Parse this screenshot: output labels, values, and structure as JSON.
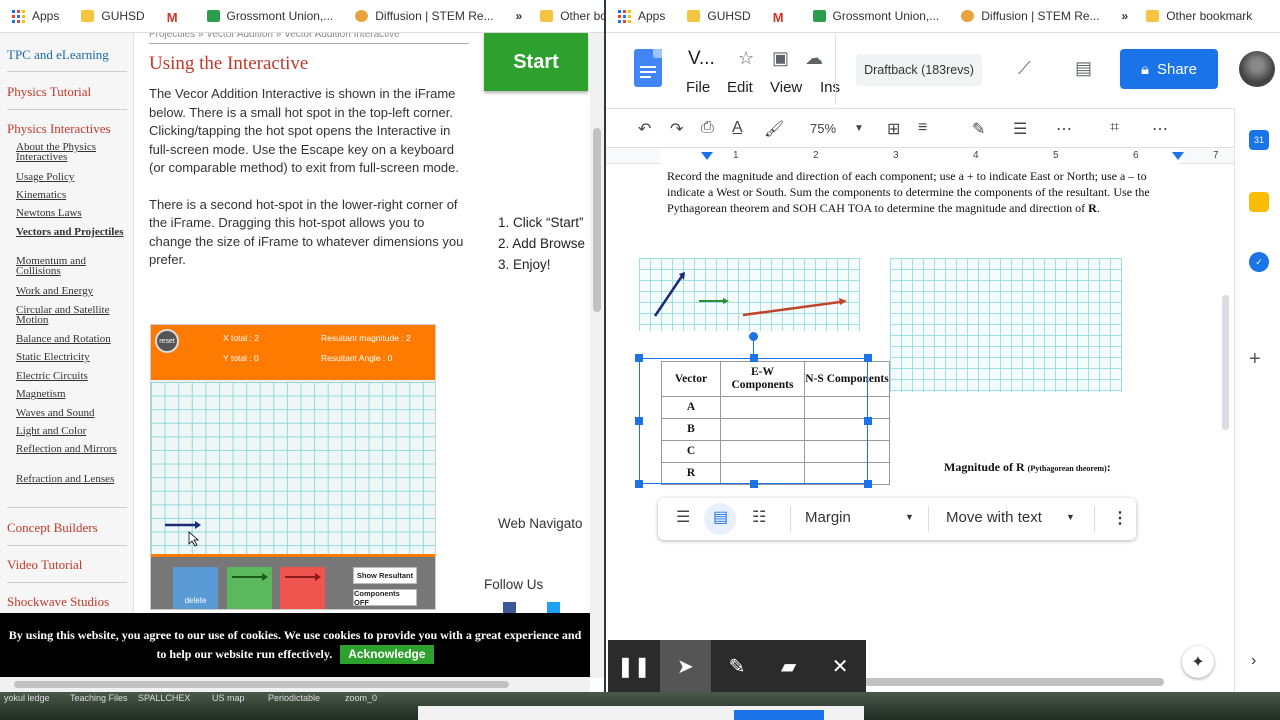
{
  "bookmarks": {
    "apps": "Apps",
    "guhsd": "GUHSD",
    "gmail": "M",
    "grossmont": "Grossmont Union,...",
    "diffusion": "Diffusion | STEM Re...",
    "more": "»",
    "other": "Other bookmarks",
    "other_cut": "Other bookmark"
  },
  "nav": {
    "top": "TPC and eLearning",
    "tutorial": "Physics Tutorial",
    "interactives": "Physics Interactives",
    "subitems": [
      "About the Physics Interactives",
      "Usage Policy",
      "Kinematics",
      "Newtons Laws",
      "Vectors and Projectiles",
      "Momentum and Collisions",
      "Work and Energy",
      "Circular and Satellite Motion",
      "Balance and Rotation",
      "Static Electricity",
      "Electric Circuits",
      "Magnetism",
      "Waves and Sound",
      "Light and Color",
      "Reflection and Mirrors",
      "Refraction and Lenses"
    ],
    "concept": "Concept Builders",
    "video": "Video Tutorial",
    "shockwave": "Shockwave Studios"
  },
  "content": {
    "breadcrumb": "Projectiles » Vector Addition » Vector Addition Interactive",
    "heading": "Using the Interactive",
    "p1": "The Vecor Addition Interactive is shown in the iFrame below. There is a small hot spot in the top-left corner. Clicking/tapping the hot spot opens the Interactive in full-screen mode. Use the Escape key on a keyboard (or comparable method) to exit from full-screen mode.",
    "p2": "There is a second hot-spot in the lower-right corner of the iFrame. Dragging this hot-spot allows you to change the size of iFrame to whatever dimensions you prefer.",
    "start": "Start",
    "steps": [
      "1. Click “Start”",
      "2. Add Browse",
      "3. Enjoy!"
    ],
    "web_nav": "Web Navigato",
    "follow": "Follow Us"
  },
  "interactive": {
    "reset": "reset",
    "x_total": "X total :  2",
    "y_total": "Y total :  0",
    "res_mag": "Resultant magnitude :  2",
    "res_angle": "Resultant Angle :  0",
    "delete": "delete",
    "show_resultant": "Show Resultant",
    "components": "Components OFF",
    "colors": {
      "orange": "#ff7a00",
      "blue": "#5b9bd5",
      "green": "#5cb85c",
      "red": "#f0544f"
    }
  },
  "cookie": {
    "text": "By using this website, you agree to our use of cookies. We use cookies to provide you with a great experience and to help our website run effectively.",
    "button": "Acknowledge"
  },
  "docs": {
    "title": "V...",
    "menus": [
      "File",
      "Edit",
      "View",
      "Ins"
    ],
    "draftback": "Draftback (183revs)",
    "share": "Share",
    "zoom": "75%",
    "ruler": [
      "1",
      "2",
      "3",
      "4",
      "5",
      "6",
      "7"
    ],
    "instructions_1": "Record the magnitude and direction of each component; use a + to indicate East or North; use a – to indicate a West or South. Sum the components to determine the components of the resultant. Use the  Pythagorean theorem and SOH CAH TOA to determine the magnitude and direction of ",
    "instructions_bold": "R",
    "instructions_end": ".",
    "table": {
      "headers": [
        "Vector",
        "E-W Components",
        "N-S Components"
      ],
      "rows": [
        "A",
        "B",
        "C",
        "R"
      ]
    },
    "magnitude_label": "Magnitude of R",
    "magnitude_small": "(Pythagorean theorem)",
    "magnitude_colon": ":",
    "image_bar": {
      "wrap": "Margin",
      "position": "Move with text"
    },
    "calendar_badge": "31"
  },
  "desktop": {
    "items": [
      "yokul ledge",
      "Teaching Files",
      "SPALLCHEX",
      "US map",
      "Periodictable",
      "zoom_0"
    ]
  }
}
